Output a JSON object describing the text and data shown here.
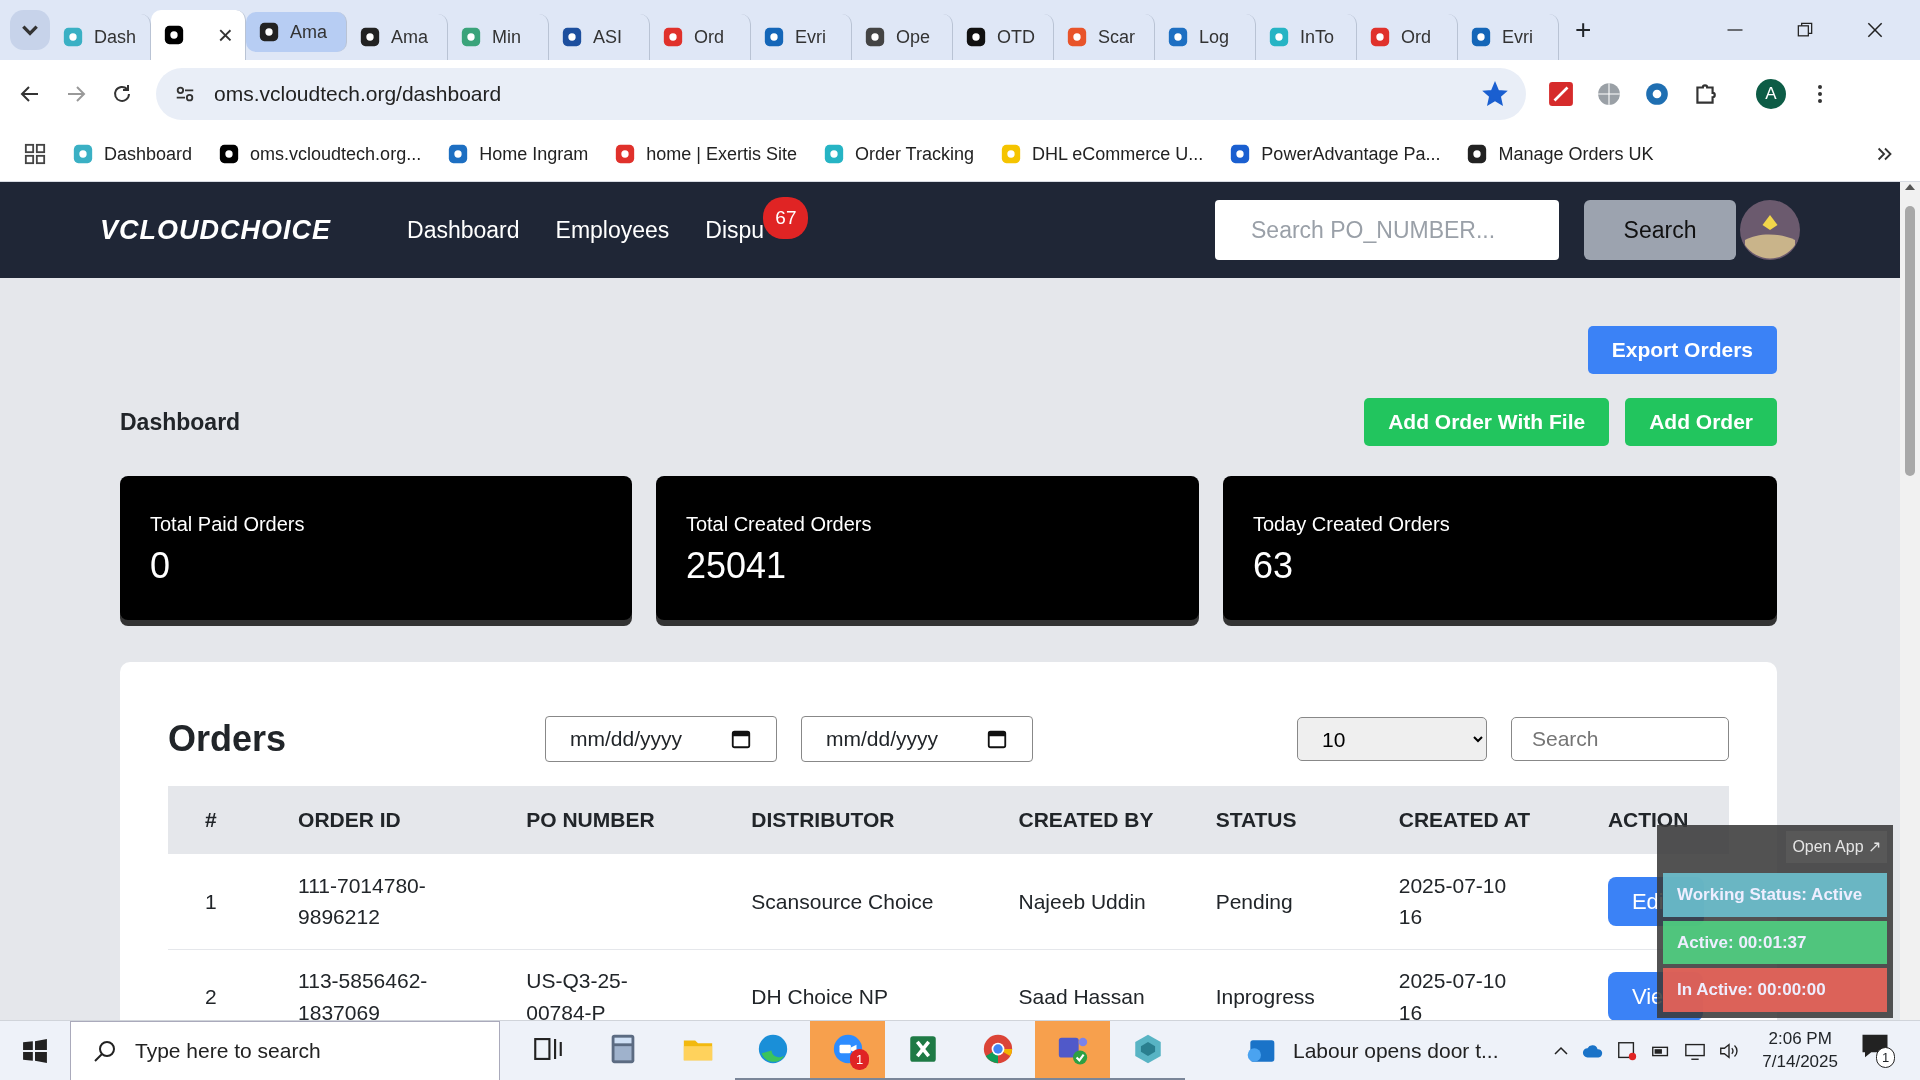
{
  "browser": {
    "tabs": [
      {
        "label": "Dash",
        "color": "#3ab0c4",
        "selected": false,
        "hovered": false
      },
      {
        "close": "×",
        "color": "#000000",
        "selected": true,
        "hovered": false
      },
      {
        "label": "Ama",
        "color": "#222222",
        "selected": false,
        "hovered": true
      },
      {
        "label": "Ama",
        "color": "#222222",
        "selected": false,
        "hovered": false
      },
      {
        "label": "Min",
        "color": "#3aa37a",
        "selected": false,
        "hovered": false
      },
      {
        "label": "ASI",
        "color": "#1d4f9e",
        "selected": false,
        "hovered": false
      },
      {
        "label": "Ord",
        "color": "#e0312b",
        "selected": false,
        "hovered": false
      },
      {
        "label": "Evri",
        "color": "#1466b8",
        "selected": false,
        "hovered": false
      },
      {
        "label": "Ope",
        "color": "#444444",
        "selected": false,
        "hovered": false
      },
      {
        "label": "OTD",
        "color": "#111111",
        "selected": false,
        "hovered": false
      },
      {
        "label": "Scar",
        "color": "#e8542a",
        "selected": false,
        "hovered": false
      },
      {
        "label": "Log",
        "color": "#1d6fc2",
        "selected": false,
        "hovered": false
      },
      {
        "label": "InTo",
        "color": "#26b4c4",
        "selected": false,
        "hovered": false
      },
      {
        "label": "Ord",
        "color": "#e0312b",
        "selected": false,
        "hovered": false
      },
      {
        "label": "Evri",
        "color": "#1466b8",
        "selected": false,
        "hovered": false
      }
    ],
    "new_tab": "+",
    "url": "oms.vcloudtech.org/dashboard",
    "bookmarked": true,
    "profile": "A",
    "bookmarks": [
      {
        "label": "Dashboard",
        "color": "#3ab0c4"
      },
      {
        "label": "oms.vcloudtech.org...",
        "color": "#000000"
      },
      {
        "label": "Home Ingram",
        "color": "#1d6fc2"
      },
      {
        "label": "home | Exertis Site",
        "color": "#e0312b"
      },
      {
        "label": "Order Tracking",
        "color": "#26b4c4"
      },
      {
        "label": "DHL eCommerce U...",
        "color": "#f5c400"
      },
      {
        "label": "PowerAdvantage Pa...",
        "color": "#1a5fd0"
      },
      {
        "label": "Manage Orders UK",
        "color": "#222222"
      }
    ]
  },
  "app": {
    "logo": "VCLOUDCHOICE",
    "nav": [
      {
        "label": "Dashboard"
      },
      {
        "label": "Employees"
      },
      {
        "label": "Dispu",
        "badge": "67"
      }
    ],
    "search": {
      "placeholder": "Search PO_NUMBER...",
      "button": "Search"
    }
  },
  "page": {
    "export_button": "Export Orders",
    "title": "Dashboard",
    "add_buttons": [
      "Add Order With File",
      "Add Order"
    ],
    "stats": [
      {
        "label": "Total Paid Orders",
        "value": "0"
      },
      {
        "label": "Total Created Orders",
        "value": "25041"
      },
      {
        "label": "Today Created Orders",
        "value": "63"
      }
    ],
    "orders": {
      "title": "Orders",
      "date_filters": [
        {
          "text": "mm/dd/yyyy"
        },
        {
          "text": "mm/dd/yyyy"
        }
      ],
      "page_size": "10",
      "search": {
        "placeholder": "Search"
      },
      "columns": [
        "#",
        "ORDER ID",
        "PO NUMBER",
        "DISTRIBUTOR",
        "CREATED BY",
        "STATUS",
        "CREATED AT",
        "ACTION"
      ],
      "rows": [
        {
          "cells": [
            "1",
            "111-7014780-9896212",
            "",
            "Scansource Choice",
            "Najeeb Uddin",
            "Pending",
            "2025-07-10 16"
          ],
          "action": "Edi"
        },
        {
          "cells": [
            "2",
            "113-5856462-1837069",
            "US-Q3-25-00784-P",
            "DH Choice NP",
            "Saad Hassan",
            "Inprogress",
            "2025-07-10 16"
          ],
          "action": "Vie"
        }
      ]
    }
  },
  "widget": {
    "link": "Open App ↗",
    "status": "Working Status: Active",
    "active": "Active: 00:01:37",
    "inactive": "In Active: 00:00:00"
  },
  "taskbar": {
    "search_placeholder": "Type here to search",
    "apps": [
      {
        "kind": "taskview",
        "open": false,
        "flashing": false
      },
      {
        "kind": "calculator",
        "open": false,
        "flashing": false
      },
      {
        "kind": "folder",
        "open": false,
        "flashing": false
      },
      {
        "kind": "edge",
        "open": true,
        "flashing": false
      },
      {
        "kind": "zoom",
        "open": true,
        "flashing": true,
        "badge": "1"
      },
      {
        "kind": "excel",
        "open": true,
        "flashing": false
      },
      {
        "kind": "chrome",
        "open": true,
        "flashing": false
      },
      {
        "kind": "teams",
        "open": true,
        "flashing": true
      },
      {
        "kind": "app",
        "open": true,
        "flashing": false
      }
    ],
    "news": "Labour opens door t...",
    "time": "2:06 PM",
    "date": "7/14/2025",
    "notifications": "1"
  }
}
